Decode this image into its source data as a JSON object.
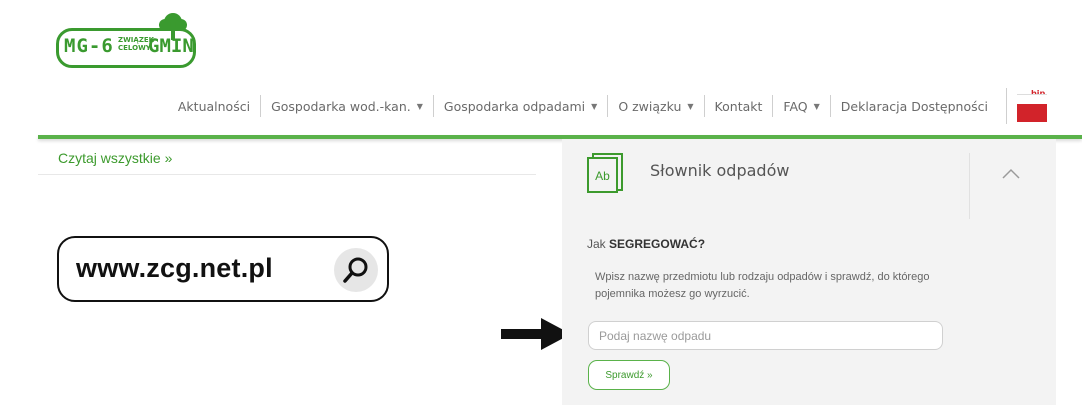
{
  "logo": {
    "text_left": "MG-6",
    "text_small": "ZWIĄZEK CELOWY",
    "text_right": "GMIN"
  },
  "nav": {
    "items": [
      {
        "label": "Aktualności",
        "dropdown": false
      },
      {
        "label": "Gospodarka wod.-kan.",
        "dropdown": true
      },
      {
        "label": "Gospodarka odpadami",
        "dropdown": true
      },
      {
        "label": "O związku",
        "dropdown": true
      },
      {
        "label": "Kontakt",
        "dropdown": false
      },
      {
        "label": "FAQ",
        "dropdown": true
      },
      {
        "label": "Deklaracja Dostępności",
        "dropdown": false
      }
    ],
    "bip_label": "bip"
  },
  "left": {
    "read_all": "Czytaj wszystkie »",
    "url_badge": "www.zcg.net.pl"
  },
  "panel": {
    "icon_text": "Ab",
    "title": "Słownik odpadów",
    "question_prefix": "Jak ",
    "question_bold": "SEGREGOWAĆ?",
    "description": "Wpisz nazwę przedmiotu lub rodzaju odpadów i sprawdź, do którego pojemnika możesz go wyrzucić.",
    "input_placeholder": "Podaj nazwę odpadu",
    "input_value": "",
    "button_label": "Sprawdź »"
  },
  "colors": {
    "brand_green": "#3c9a2d",
    "bar_green": "#5ab24a",
    "bip_red": "#d2232a",
    "panel_bg": "#f3f3f3"
  },
  "icons": [
    "tree-logo-icon",
    "caret-down-icon",
    "bip-flag-icon",
    "search-icon",
    "arrow-right-icon",
    "dictionary-book-icon",
    "chevron-up-icon"
  ]
}
